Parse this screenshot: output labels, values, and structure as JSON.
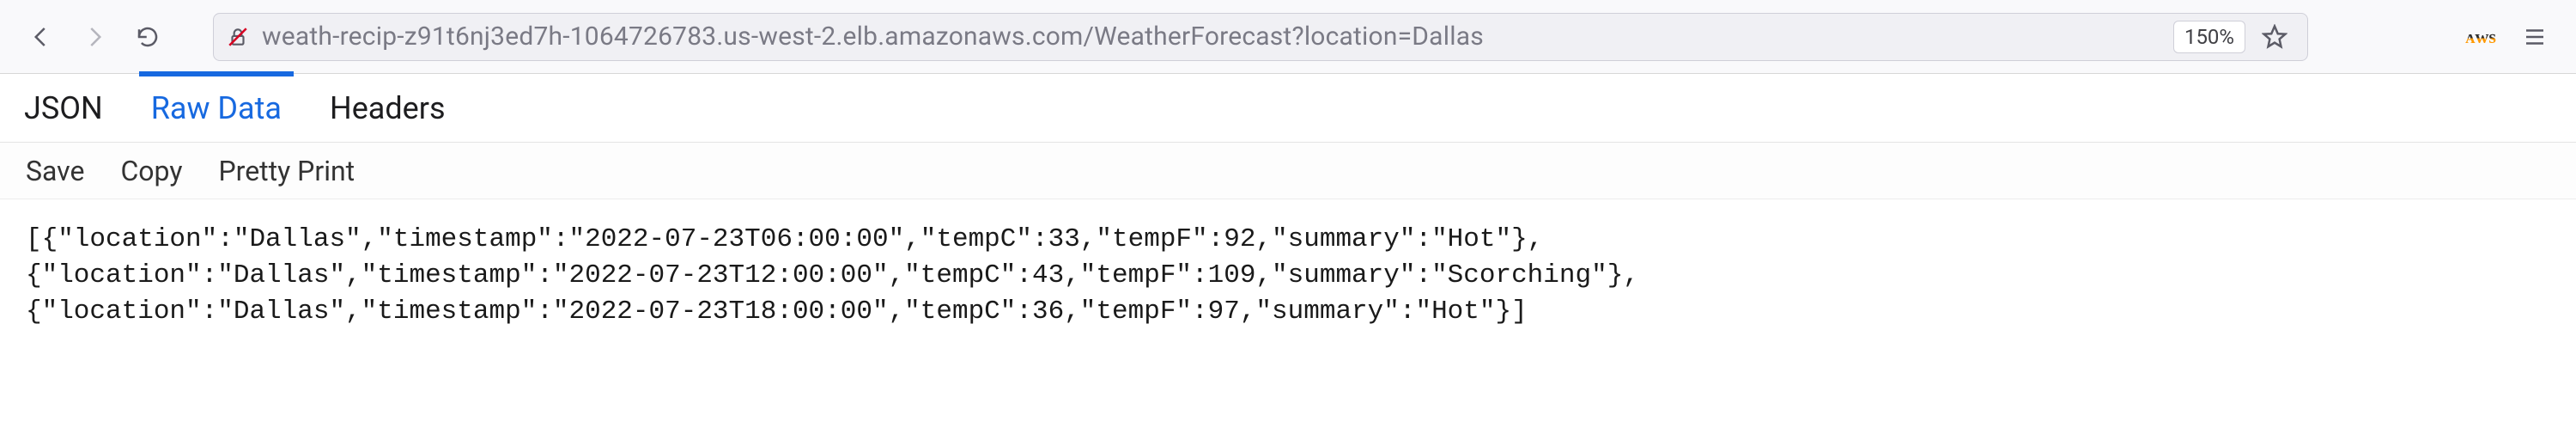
{
  "toolbar": {
    "url": "weath-recip-z91t6nj3ed7h-1064726783.us-west-2.elb.amazonaws.com/WeatherForecast?location=Dallas",
    "zoom_label": "150%"
  },
  "viewer": {
    "tabs": {
      "json": "JSON",
      "raw": "Raw Data",
      "headers": "Headers"
    },
    "actions": {
      "save": "Save",
      "copy": "Copy",
      "pretty": "Pretty Print"
    }
  },
  "raw_lines": [
    "[{\"location\":\"Dallas\",\"timestamp\":\"2022-07-23T06:00:00\",\"tempC\":33,\"tempF\":92,\"summary\":\"Hot\"},",
    "{\"location\":\"Dallas\",\"timestamp\":\"2022-07-23T12:00:00\",\"tempC\":43,\"tempF\":109,\"summary\":\"Scorching\"},",
    "{\"location\":\"Dallas\",\"timestamp\":\"2022-07-23T18:00:00\",\"tempC\":36,\"tempF\":97,\"summary\":\"Hot\"}]"
  ]
}
